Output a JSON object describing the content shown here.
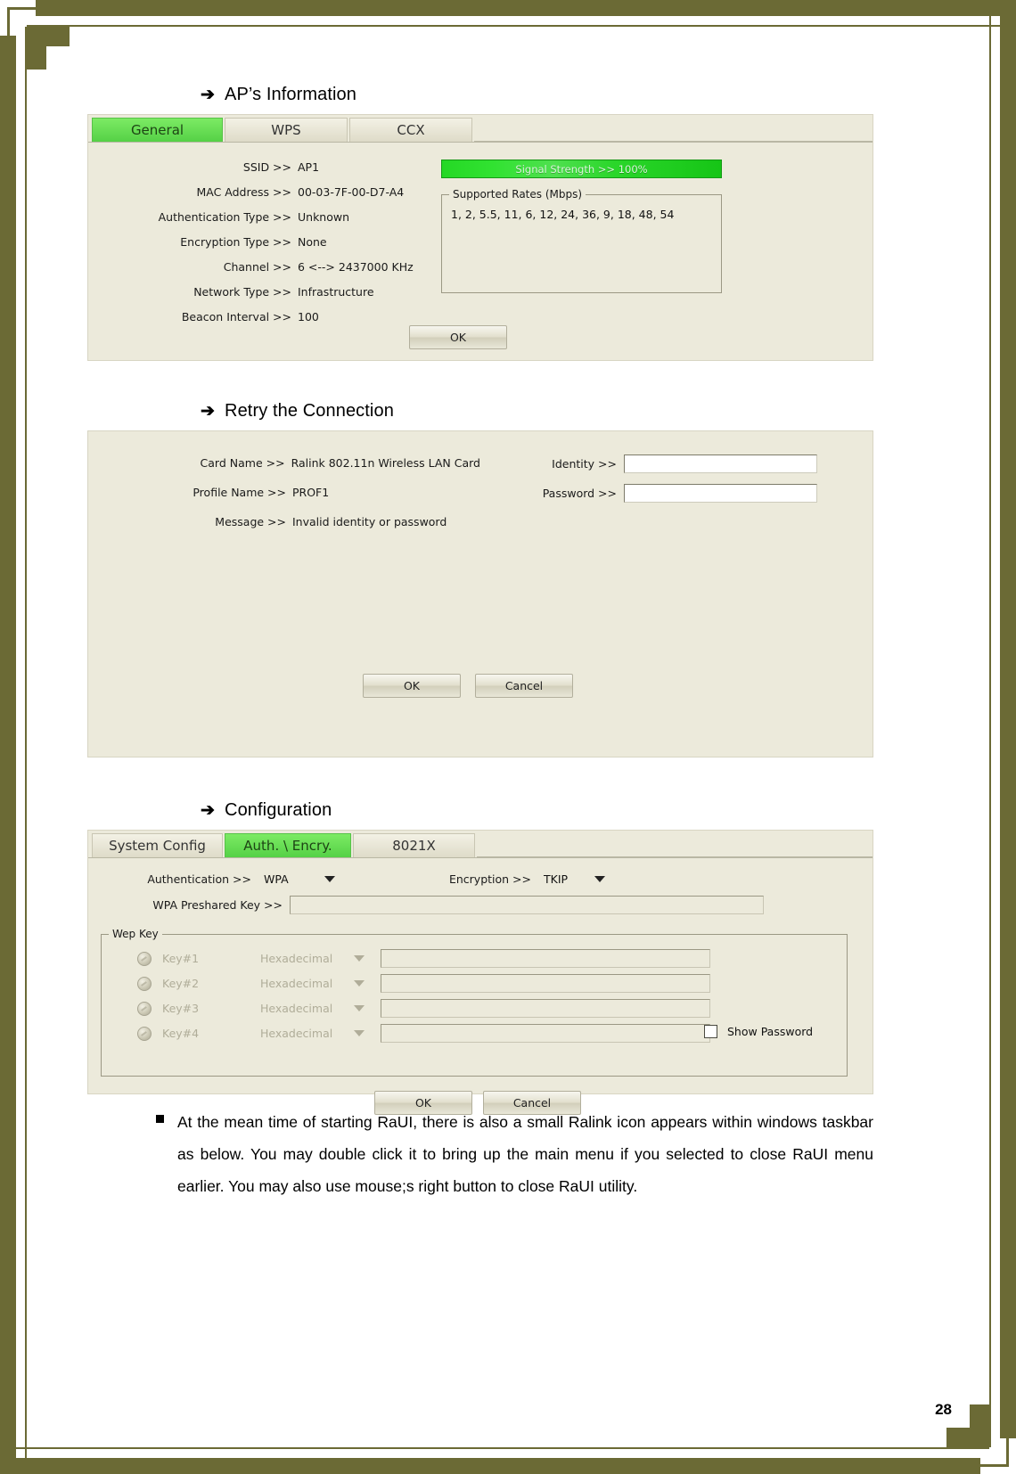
{
  "page": {
    "number": "28",
    "border_color": "#6b6a35"
  },
  "sections": [
    {
      "heading": "AP’s Information",
      "arrow": "➔"
    },
    {
      "heading": "Retry the Connection",
      "arrow": "➔"
    },
    {
      "heading": "Configuration",
      "arrow": "➔"
    }
  ],
  "ap_information": {
    "tabs": [
      {
        "label": "General",
        "active": true
      },
      {
        "label": "WPS",
        "active": false
      },
      {
        "label": "CCX",
        "active": false
      }
    ],
    "fields": [
      {
        "label": "SSID >>",
        "value": "AP1"
      },
      {
        "label": "MAC Address >>",
        "value": "00-03-7F-00-D7-A4"
      },
      {
        "label": "Authentication Type >>",
        "value": "Unknown"
      },
      {
        "label": "Encryption Type >>",
        "value": "None"
      },
      {
        "label": "Channel >>",
        "value": "6 <--> 2437000 KHz"
      },
      {
        "label": "Network Type >>",
        "value": "Infrastructure"
      },
      {
        "label": "Beacon Interval >>",
        "value": "100"
      }
    ],
    "signal_strength": {
      "text": "Signal Strength >> 100%",
      "percent": 100,
      "color": "#25d825"
    },
    "supported_rates": {
      "legend": "Supported Rates (Mbps)",
      "values": "1, 2, 5.5, 11, 6, 12, 24, 36, 9, 18, 48, 54"
    },
    "ok_button": "OK"
  },
  "retry_connection": {
    "fields": [
      {
        "label": "Card Name >>",
        "value": "Ralink 802.11n Wireless LAN Card"
      },
      {
        "label": "Profile Name >>",
        "value": "PROF1"
      },
      {
        "label": "Message >>",
        "value": "Invalid identity or password"
      }
    ],
    "credentials": [
      {
        "label": "Identity >>",
        "value": "",
        "placeholder": ""
      },
      {
        "label": "Password >>",
        "value": "",
        "placeholder": ""
      }
    ],
    "ok_button": "OK",
    "cancel_button": "Cancel"
  },
  "configuration": {
    "tabs": [
      {
        "label": "System Config",
        "active": false
      },
      {
        "label": "Auth. \\ Encry.",
        "active": true
      },
      {
        "label": "8021X",
        "active": false
      }
    ],
    "authentication": {
      "label": "Authentication >>",
      "value": "WPA"
    },
    "encryption": {
      "label": "Encryption >>",
      "value": "TKIP"
    },
    "wpa_preshared_key": {
      "label": "WPA Preshared Key >>",
      "value": ""
    },
    "wep_key": {
      "legend": "Wep Key",
      "rows": [
        {
          "key_label": "Key#1",
          "format": "Hexadecimal",
          "value": ""
        },
        {
          "key_label": "Key#2",
          "format": "Hexadecimal",
          "value": ""
        },
        {
          "key_label": "Key#3",
          "format": "Hexadecimal",
          "value": ""
        },
        {
          "key_label": "Key#4",
          "format": "Hexadecimal",
          "value": ""
        }
      ]
    },
    "show_password": {
      "label": "Show Password",
      "checked": false
    },
    "ok_button": "OK",
    "cancel_button": "Cancel"
  },
  "note": {
    "bullet": "■",
    "text": "At the mean time of starting RaUI, there is also a small Ralink icon appears within windows taskbar as below. You may double click it to bring up the main menu if you selected to close RaUI menu earlier. You may also use mouse;s right button to close RaUI utility."
  }
}
